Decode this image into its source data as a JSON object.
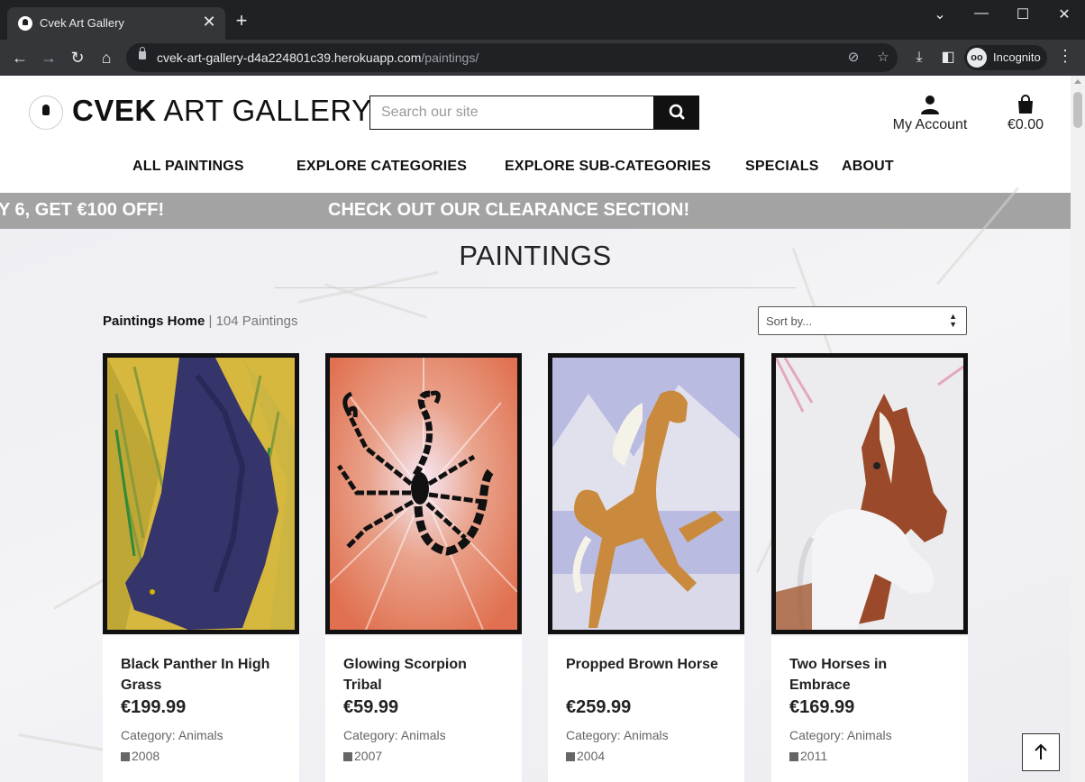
{
  "browser": {
    "tab_title": "Cvek Art Gallery",
    "url_host": "cvek-art-gallery-d4a224801c39.herokuapp.com",
    "url_path": "/paintings/",
    "incognito_label": "Incognito"
  },
  "header": {
    "title_bold": "CVEK",
    "title_rest": " ART GALLERY",
    "search_placeholder": "Search our site",
    "account_label": "My Account",
    "bag_total": "€0.00"
  },
  "nav": {
    "items": [
      "ALL PAINTINGS",
      "EXPLORE CATEGORIES",
      "EXPLORE SUB-CATEGORIES",
      "SPECIALS",
      "ABOUT"
    ]
  },
  "banner": {
    "messages": [
      "Y 6, GET €100 OFF!",
      "CHECK OUT OUR CLEARANCE SECTION!"
    ]
  },
  "main": {
    "heading": "PAINTINGS",
    "crumb_home": "Paintings Home",
    "crumb_sep": " | ",
    "crumb_count": "104 Paintings",
    "sort_placeholder": "Sort by..."
  },
  "products": [
    {
      "name": "Black Panther In High Grass",
      "price": "€199.99",
      "category": "Category: Animals",
      "year": "2008",
      "image": "panther"
    },
    {
      "name": "Glowing Scorpion Tribal",
      "price": "€59.99",
      "category": "Category: Animals",
      "year": "2007",
      "image": "scorpion"
    },
    {
      "name": "Propped Brown Horse",
      "price": "€259.99",
      "category": "Category: Animals",
      "year": "2004",
      "image": "rearing-horse"
    },
    {
      "name": "Two Horses in Embrace",
      "price": "€169.99",
      "category": "Category: Animals",
      "year": "2011",
      "image": "two-horses"
    }
  ],
  "colors": {
    "banner": "#a3a3a3",
    "chrome_dark": "#202124",
    "chrome_toolbar": "#35363a"
  }
}
